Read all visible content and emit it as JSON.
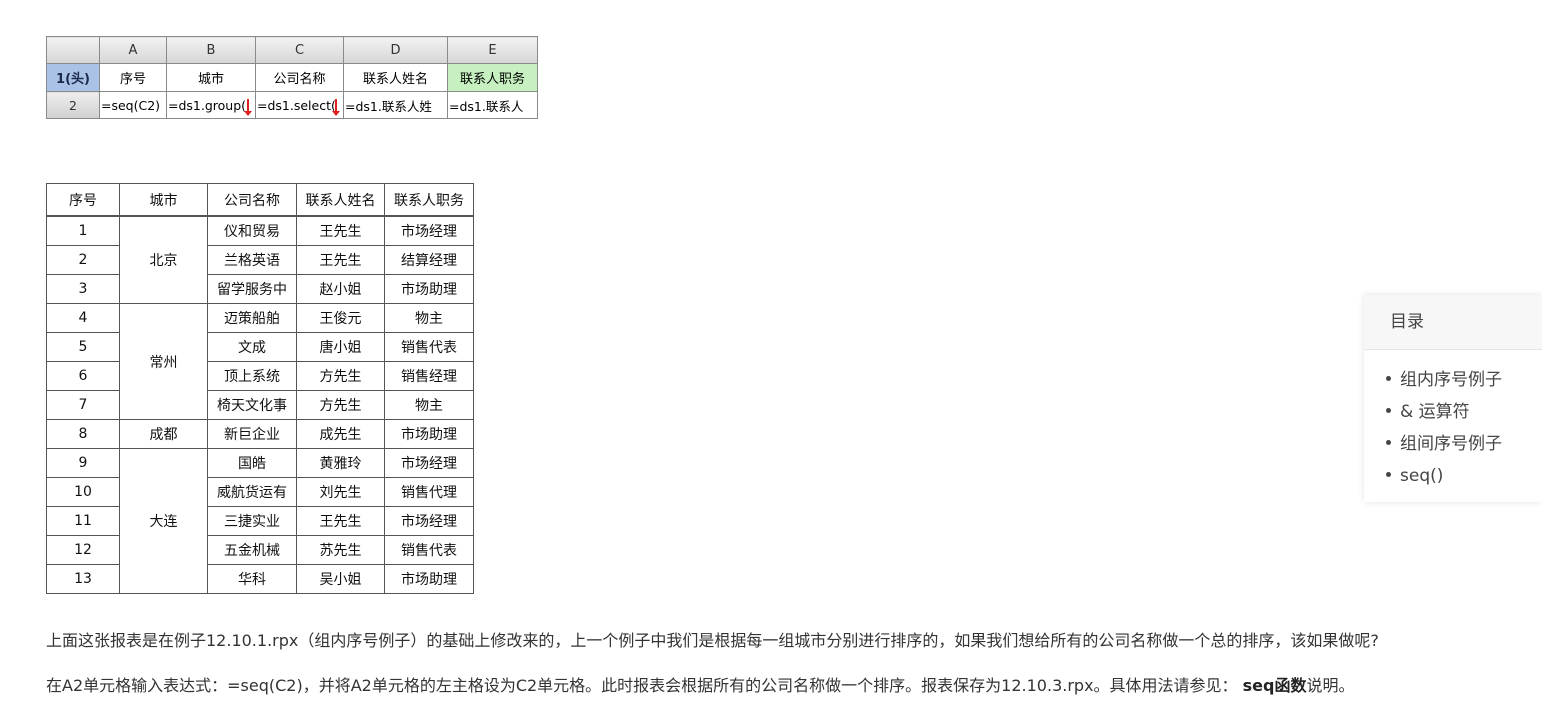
{
  "designer": {
    "column_letters": [
      "A",
      "B",
      "C",
      "D",
      "E"
    ],
    "row1_label": "1(头)",
    "row1_cells": [
      "序号",
      "城市",
      "公司名称",
      "联系人姓名",
      "联系人职务"
    ],
    "row2_label": "2",
    "row2_cells": [
      "=seq(C2)",
      "=ds1.group(",
      "=ds1.select(",
      "=ds1.联系人姓",
      "=ds1.联系人"
    ],
    "header_highlight_color": "#a9c2e6",
    "green_cell_color": "#c6f0c0",
    "expand_arrow_color": "#e02020"
  },
  "result_table": {
    "headers": [
      "序号",
      "城市",
      "公司名称",
      "联系人姓名",
      "联系人职务"
    ],
    "groups": [
      {
        "city": "北京",
        "rows": [
          {
            "seq": "1",
            "company": "仪和贸易",
            "name": "王先生",
            "title": "市场经理"
          },
          {
            "seq": "2",
            "company": "兰格英语",
            "name": "王先生",
            "title": "结算经理"
          },
          {
            "seq": "3",
            "company": "留学服务中",
            "name": "赵小姐",
            "title": "市场助理"
          }
        ]
      },
      {
        "city": "常州",
        "rows": [
          {
            "seq": "4",
            "company": "迈策船舶",
            "name": "王俊元",
            "title": "物主"
          },
          {
            "seq": "5",
            "company": "文成",
            "name": "唐小姐",
            "title": "销售代表"
          },
          {
            "seq": "6",
            "company": "顶上系统",
            "name": "方先生",
            "title": "销售经理"
          },
          {
            "seq": "7",
            "company": "椅天文化事",
            "name": "方先生",
            "title": "物主"
          }
        ]
      },
      {
        "city": "成都",
        "rows": [
          {
            "seq": "8",
            "company": "新巨企业",
            "name": "成先生",
            "title": "市场助理"
          }
        ]
      },
      {
        "city": "大连",
        "rows": [
          {
            "seq": "9",
            "company": "国皓",
            "name": "黄雅玲",
            "title": "市场经理"
          },
          {
            "seq": "10",
            "company": "威航货运有",
            "name": "刘先生",
            "title": "销售代理"
          },
          {
            "seq": "11",
            "company": "三捷实业",
            "name": "王先生",
            "title": "市场经理"
          },
          {
            "seq": "12",
            "company": "五金机械",
            "name": "苏先生",
            "title": "销售代表"
          },
          {
            "seq": "13",
            "company": "华科",
            "name": "吴小姐",
            "title": "市场助理"
          }
        ]
      }
    ]
  },
  "toc": {
    "title": "目录",
    "items": [
      "组内序号例子",
      "& 运算符",
      "组间序号例子",
      "seq()"
    ]
  },
  "paragraphs": {
    "p1": "上面这张报表是在例子12.10.1.rpx（组内序号例子）的基础上修改来的，上一个例子中我们是根据每一组城市分别进行排序的，如果我们想给所有的公司名称做一个总的排序，该如果做呢?",
    "p2_text": "在A2单元格输入表达式：=seq(C2)，并将A2单元格的左主格设为C2单元格。此时报表会根据所有的公司名称做一个排序。报表保存为12.10.3.rpx。具体用法请参见：",
    "p2_link": "seq函数",
    "p2_tail": "说明。"
  }
}
